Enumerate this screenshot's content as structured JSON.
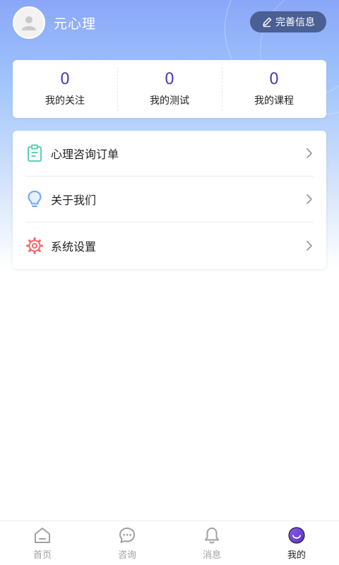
{
  "profile": {
    "username": "元心理",
    "edit_label": "完善信息"
  },
  "stats": [
    {
      "value": "0",
      "label": "我的关注"
    },
    {
      "value": "0",
      "label": "我的测试"
    },
    {
      "value": "0",
      "label": "我的课程"
    }
  ],
  "menu": [
    {
      "label": "心理咨询订单",
      "icon": "clipboard-icon"
    },
    {
      "label": "关于我们",
      "icon": "lightbulb-icon"
    },
    {
      "label": "系统设置",
      "icon": "gear-icon"
    }
  ],
  "tabs": [
    {
      "label": "首页",
      "icon": "home-icon"
    },
    {
      "label": "咨询",
      "icon": "chat-bubble-icon"
    },
    {
      "label": "消息",
      "icon": "bell-icon"
    },
    {
      "label": "我的",
      "icon": "smiley-icon",
      "active": true
    }
  ],
  "colors": {
    "accent": "#4a3fb0",
    "edit_button": "#4a5f93",
    "clipboard_icon": "#5fcfb8",
    "lightbulb_icon": "#6aa6f2",
    "gear_icon": "#f26a6a",
    "active_tab": "#6b3fd8"
  }
}
